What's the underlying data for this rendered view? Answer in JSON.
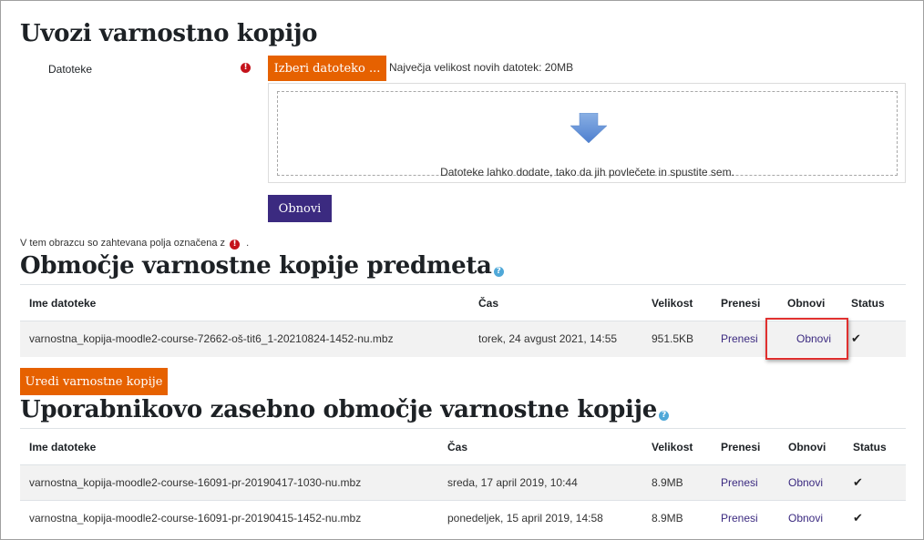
{
  "import": {
    "title": "Uvozi varnostno kopijo",
    "files_label": "Datoteke",
    "choose_button": "Izberi datoteko ...",
    "max_size": "Največja velikost novih datotek: 20MB",
    "drop_text": "Datoteke lahko dodate, tako da jih povlečete in spustite sem.",
    "restore_button": "Obnovi",
    "required_note": "V tem obrazcu so zahtevana polja označena z",
    "required_note_end": "."
  },
  "course_area": {
    "title": "Območje varnostne kopije predmeta",
    "columns": [
      "Ime datoteke",
      "Čas",
      "Velikost",
      "Prenesi",
      "Obnovi",
      "Status"
    ],
    "rows": [
      {
        "filename": "varnostna_kopija-moodle2-course-72662-oš-tit6_1-20210824-1452-nu.mbz",
        "time": "torek, 24 avgust 2021, 14:55",
        "size": "951.5KB",
        "download": "Prenesi",
        "restore": "Obnovi",
        "status": "✔"
      }
    ],
    "manage_button": "Uredi varnostne kopije"
  },
  "user_area": {
    "title": "Uporabnikovo zasebno območje varnostne kopije",
    "columns": [
      "Ime datoteke",
      "Čas",
      "Velikost",
      "Prenesi",
      "Obnovi",
      "Status"
    ],
    "rows": [
      {
        "filename": "varnostna_kopija-moodle2-course-16091-pr-20190417-1030-nu.mbz",
        "time": "sreda, 17 april 2019, 10:44",
        "size": "8.9MB",
        "download": "Prenesi",
        "restore": "Obnovi",
        "status": "✔"
      },
      {
        "filename": "varnostna_kopija-moodle2-course-16091-pr-20190415-1452-nu.mbz",
        "time": "ponedeljek, 15 april 2019, 14:58",
        "size": "8.9MB",
        "download": "Prenesi",
        "restore": "Obnovi",
        "status": "✔"
      }
    ]
  },
  "icons": {
    "required": "exclamation-circle-icon",
    "help": "question-circle-icon",
    "drop_arrow": "arrow-down-icon",
    "status_ok": "check-icon"
  },
  "colors": {
    "primary_orange": "#e66100",
    "primary_purple": "#3b2a80",
    "required_red": "#c4131b",
    "help_blue": "#4fa8d8",
    "highlight_red": "#e0302f"
  }
}
